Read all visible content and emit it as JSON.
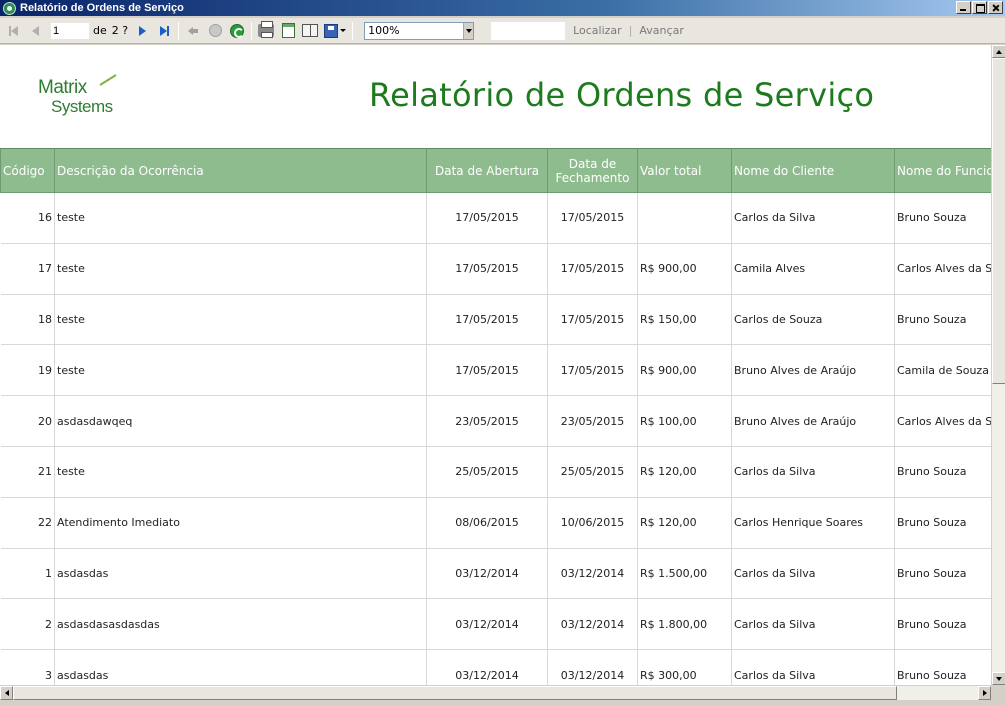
{
  "window": {
    "title": "Relatório de Ordens de Serviço"
  },
  "toolbar": {
    "current_page": "1",
    "of_label": "de",
    "total_pages": "2 ?",
    "zoom": "100%",
    "find_value": "",
    "find_label": "Localizar",
    "next_label": "Avançar",
    "separator": "|"
  },
  "report": {
    "logo_line1": "Matrix",
    "logo_line2": "Systems",
    "title": "Relatório de Ordens de Serviço",
    "columns": [
      "Código",
      "Descrição da Ocorrência",
      "Data de Abertura",
      "Data de Fechamento",
      "Valor total",
      "Nome do Cliente",
      "Nome do Funcionário"
    ],
    "rows": [
      {
        "codigo": "16",
        "descricao": "teste",
        "abertura": "17/05/2015",
        "fechamento": "17/05/2015",
        "valor": "",
        "cliente": "Carlos da Silva",
        "funcionario": "Bruno Souza"
      },
      {
        "codigo": "17",
        "descricao": "teste",
        "abertura": "17/05/2015",
        "fechamento": "17/05/2015",
        "valor": "R$ 900,00",
        "cliente": "Camila Alves",
        "funcionario": "Carlos Alves da Silva"
      },
      {
        "codigo": "18",
        "descricao": "teste",
        "abertura": "17/05/2015",
        "fechamento": "17/05/2015",
        "valor": "R$ 150,00",
        "cliente": "Carlos de Souza",
        "funcionario": "Bruno Souza"
      },
      {
        "codigo": "19",
        "descricao": "teste",
        "abertura": "17/05/2015",
        "fechamento": "17/05/2015",
        "valor": "R$ 900,00",
        "cliente": "Bruno Alves de Araújo",
        "funcionario": "Camila de Souza"
      },
      {
        "codigo": "20",
        "descricao": "asdasdawqeq",
        "abertura": "23/05/2015",
        "fechamento": "23/05/2015",
        "valor": "R$ 100,00",
        "cliente": "Bruno Alves de Araújo",
        "funcionario": "Carlos Alves da Silva"
      },
      {
        "codigo": "21",
        "descricao": "teste",
        "abertura": "25/05/2015",
        "fechamento": "25/05/2015",
        "valor": "R$ 120,00",
        "cliente": "Carlos da Silva",
        "funcionario": "Bruno Souza"
      },
      {
        "codigo": "22",
        "descricao": "Atendimento Imediato",
        "abertura": "08/06/2015",
        "fechamento": "10/06/2015",
        "valor": "R$ 120,00",
        "cliente": "Carlos Henrique Soares",
        "funcionario": "Bruno Souza"
      },
      {
        "codigo": "1",
        "descricao": "asdasdas",
        "abertura": "03/12/2014",
        "fechamento": "03/12/2014",
        "valor": "R$ 1.500,00",
        "cliente": "Carlos da Silva",
        "funcionario": "Bruno Souza"
      },
      {
        "codigo": "2",
        "descricao": "asdasdasasdasdas",
        "abertura": "03/12/2014",
        "fechamento": "03/12/2014",
        "valor": "R$ 1.800,00",
        "cliente": "Carlos da Silva",
        "funcionario": "Bruno Souza"
      },
      {
        "codigo": "3",
        "descricao": "asdasdas",
        "abertura": "03/12/2014",
        "fechamento": "03/12/2014",
        "valor": "R$ 300,00",
        "cliente": "Carlos da Silva",
        "funcionario": "Bruno Souza"
      }
    ]
  },
  "colors": {
    "header_bg": "#8fbc8f",
    "title_green": "#1d7a1d",
    "titlebar": "#0a246a"
  }
}
